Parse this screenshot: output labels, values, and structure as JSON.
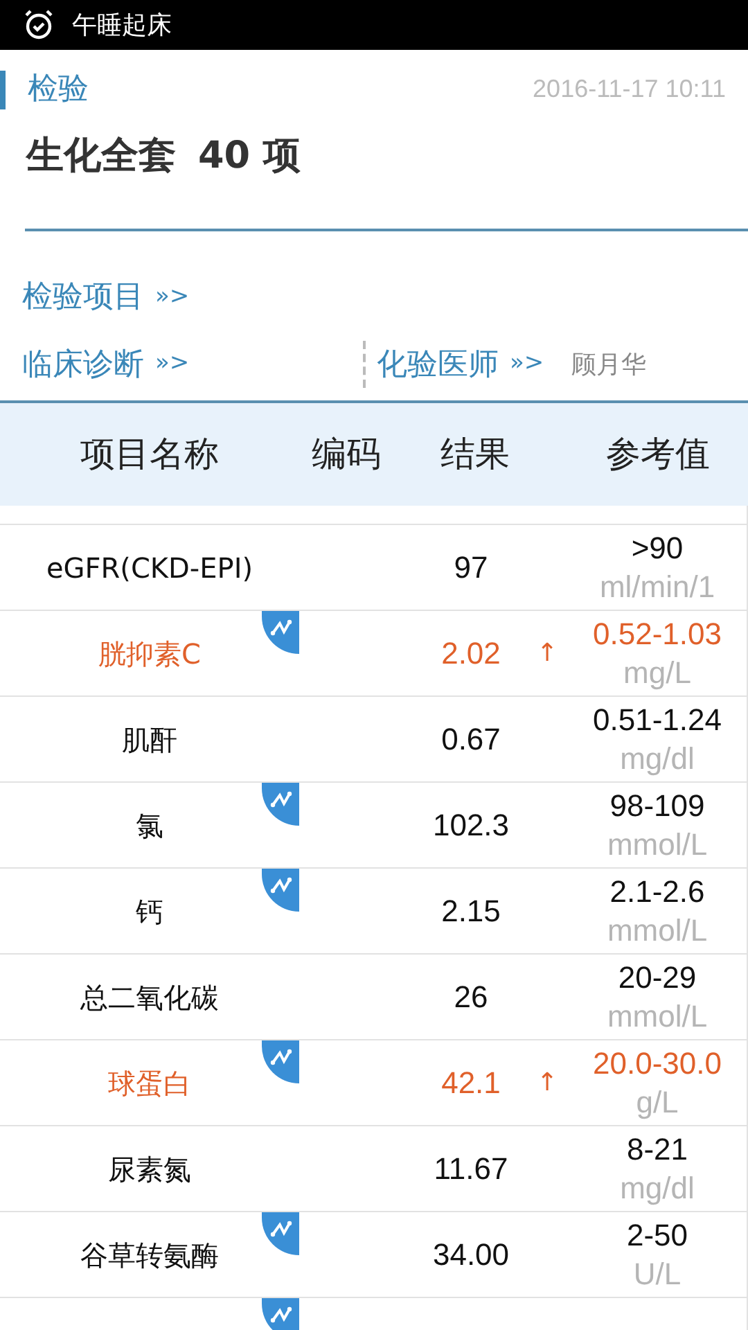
{
  "status_bar": {
    "notification": "午睡起床"
  },
  "header": {
    "section": "检验",
    "date": "2016-11-17 10:11",
    "title": "生化全套",
    "count": "40 项"
  },
  "links": [
    {
      "label": "检验项目",
      "chevrons": "»>"
    },
    {
      "label": "临床诊断",
      "chevrons": "»>"
    },
    {
      "label": "化验医师",
      "chevrons": "»>",
      "value": "顾月华"
    }
  ],
  "table": {
    "columns": [
      "项目名称",
      "编码",
      "结果",
      "参考值"
    ],
    "rows": [
      {
        "name": "eGFR(CKD-EPI)",
        "result": "97",
        "flag": "",
        "range": ">90",
        "unit": "ml/min/1",
        "abnormal": false,
        "trend": false
      },
      {
        "name": "胱抑素C",
        "result": "2.02",
        "flag": "↑",
        "range": "0.52-1.03",
        "unit": "mg/L",
        "abnormal": true,
        "trend": true
      },
      {
        "name": "肌酐",
        "result": "0.67",
        "flag": "",
        "range": "0.51-1.24",
        "unit": "mg/dl",
        "abnormal": false,
        "trend": false
      },
      {
        "name": "氯",
        "result": "102.3",
        "flag": "",
        "range": "98-109",
        "unit": "mmol/L",
        "abnormal": false,
        "trend": true
      },
      {
        "name": "钙",
        "result": "2.15",
        "flag": "",
        "range": "2.1-2.6",
        "unit": "mmol/L",
        "abnormal": false,
        "trend": true
      },
      {
        "name": "总二氧化碳",
        "result": "26",
        "flag": "",
        "range": "20-29",
        "unit": "mmol/L",
        "abnormal": false,
        "trend": false
      },
      {
        "name": "球蛋白",
        "result": "42.1",
        "flag": "↑",
        "range": "20.0-30.0",
        "unit": "g/L",
        "abnormal": true,
        "trend": true
      },
      {
        "name": "尿素氮",
        "result": "11.67",
        "flag": "",
        "range": "8-21",
        "unit": "mg/dl",
        "abnormal": false,
        "trend": false
      },
      {
        "name": "谷草转氨酶",
        "result": "34.00",
        "flag": "",
        "range": "2-50",
        "unit": "U/L",
        "abnormal": false,
        "trend": true
      }
    ],
    "cut_row": {
      "trend": true
    }
  }
}
